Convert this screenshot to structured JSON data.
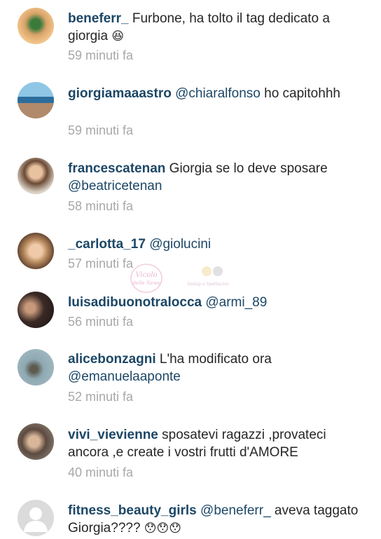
{
  "comments": [
    {
      "user": "beneferr_",
      "pre": " Furbone, ha tolto il tag dedicato a giorgia",
      "mention": "",
      "post": "",
      "emoji": "😆",
      "time": "59 minuti fa"
    },
    {
      "user": "giorgiamaaastro",
      "pre": " ",
      "mention": "@chiaralfonso",
      "post": " ho capitohhh",
      "emoji": "",
      "time": "59 minuti fa"
    },
    {
      "user": "francescatenan",
      "pre": " Giorgia se lo deve sposare ",
      "mention": "@beatricetenan",
      "post": "",
      "emoji": "",
      "time": "58 minuti fa"
    },
    {
      "user": "_carlotta_17",
      "pre": " ",
      "mention": "@giolucini",
      "post": "",
      "emoji": "",
      "time": "57 minuti fa"
    },
    {
      "user": "luisadibuonotralocca",
      "pre": " ",
      "mention": "@armi_89",
      "post": "",
      "emoji": "",
      "time": "56 minuti fa"
    },
    {
      "user": "alicebonzagni",
      "pre": " L'ha modificato ora ",
      "mention": "@emanuelaaponte",
      "post": "",
      "emoji": "",
      "time": "52 minuti fa"
    },
    {
      "user": "vivi_vievienne",
      "pre": " sposatevi ragazzi ,provateci ancora ,e create i vostri frutti d'AMORE",
      "mention": "",
      "post": "",
      "emoji": "",
      "time": "40 minuti fa"
    },
    {
      "user": "fitness_beauty_girls",
      "pre": " ",
      "mention": "@beneferr_",
      "post": "  aveva taggato Giorgia???? ",
      "emoji": "😯😯😯",
      "time": ""
    }
  ],
  "watermark": {
    "script": "Vicolo delle News",
    "small": "Gossip e Spettacolo"
  },
  "colors": {
    "username": "#1c4766",
    "timestamp": "#a8a8a8",
    "text": "#262626"
  }
}
